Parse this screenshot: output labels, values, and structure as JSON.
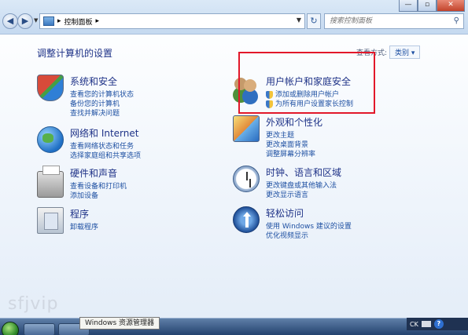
{
  "window": {
    "minimize_glyph": "—",
    "maximize_glyph": "▫",
    "close_glyph": "✕"
  },
  "address_bar": {
    "breadcrumb_sep": "▸",
    "current": "控制面板",
    "after_sep": "▸",
    "search_placeholder": "搜索控制面板"
  },
  "content": {
    "heading": "调整计算机的设置",
    "view_by_label": "查看方式:",
    "view_by_value": "类别"
  },
  "categories": [
    {
      "title": "系统和安全",
      "icon": "system-security-icon",
      "links": [
        "查看您的计算机状态",
        "备份您的计算机",
        "查找并解决问题"
      ]
    },
    {
      "title": "网络和 Internet",
      "icon": "network-globe-icon",
      "links": [
        "查看网络状态和任务",
        "选择家庭组和共享选项"
      ]
    },
    {
      "title": "硬件和声音",
      "icon": "printer-icon",
      "links": [
        "查看设备和打印机",
        "添加设备"
      ]
    },
    {
      "title": "程序",
      "icon": "programs-icon",
      "links": [
        "卸载程序"
      ]
    },
    {
      "title": "用户帐户和家庭安全",
      "icon": "users-icon",
      "links": [
        "添加或删除用户帐户",
        "为所有用户设置家长控制"
      ]
    },
    {
      "title": "外观和个性化",
      "icon": "appearance-icon",
      "links": [
        "更改主题",
        "更改桌面背景",
        "调整屏幕分辨率"
      ]
    },
    {
      "title": "时钟、语言和区域",
      "icon": "clock-globe-icon",
      "links": [
        "更改键盘或其他输入法",
        "更改显示语言"
      ]
    },
    {
      "title": "轻松访问",
      "icon": "ease-of-access-icon",
      "links": [
        "使用 Windows 建议的设置",
        "优化视频显示"
      ]
    }
  ],
  "watermark": "sfjvip",
  "taskbar": {
    "tooltip": "Windows 资源管理器",
    "tray_lang": "CK",
    "tray_help": "?"
  },
  "colors": {
    "highlight_border": "#e2182a",
    "link": "#1e50a2",
    "title": "#1e3287"
  }
}
